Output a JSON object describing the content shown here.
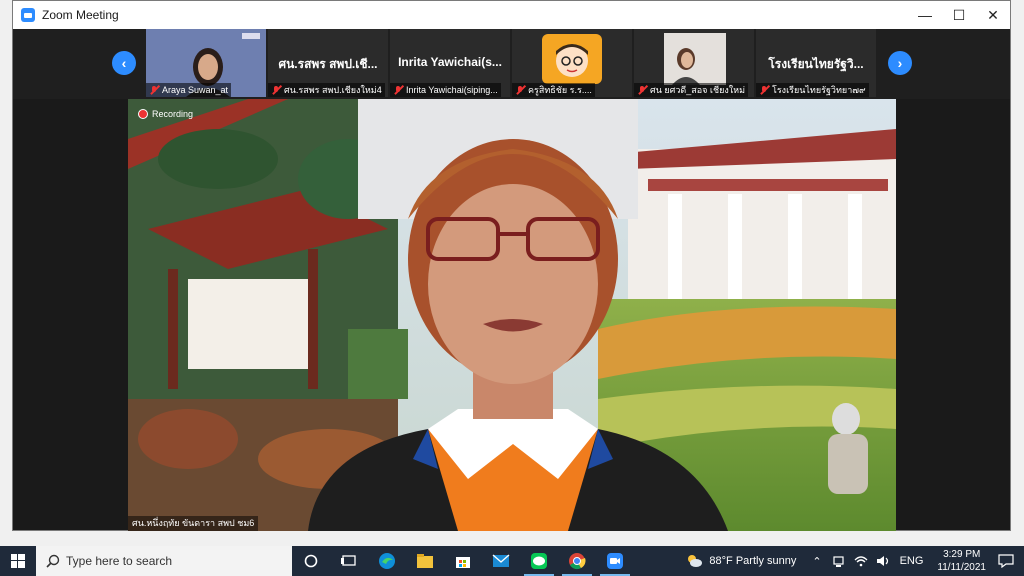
{
  "window": {
    "title": "Zoom Meeting",
    "min": "—",
    "max": "☐",
    "close": "✕"
  },
  "strip": {
    "prev": "‹",
    "next": "›",
    "tiles": [
      {
        "kind": "video",
        "label": "Araya Suwan_at"
      },
      {
        "kind": "name",
        "display": "ศน.รสพร สพป.เชี...",
        "label": "ศน.รสพร สพป.เชียงใหม่4"
      },
      {
        "kind": "name",
        "display": "Inrita Yawichai(s...",
        "label": "Inrita Yawichai(siping..."
      },
      {
        "kind": "avatar",
        "label": "ครูสิทธิชัย ร.ร...."
      },
      {
        "kind": "video",
        "label": "ศน ยศวดี_สอจ เชียงใหม่"
      },
      {
        "kind": "name",
        "display": "โรงเรียนไทยรัฐวิ...",
        "label": "โรงเรียนไทยรัฐวิทยา๗๙"
      }
    ]
  },
  "main_video": {
    "recording": "Recording",
    "label": "ศน.หนึ่งฤทัย ขันดารา สพป ชม6"
  },
  "taskbar": {
    "search_placeholder": "Type here to search",
    "weather": "88°F  Partly sunny",
    "lang": "ENG",
    "time": "3:29 PM",
    "date": "11/11/2021"
  },
  "colors": {
    "zoom_blue": "#2d8cff",
    "taskbar": "#1f2a3a"
  }
}
